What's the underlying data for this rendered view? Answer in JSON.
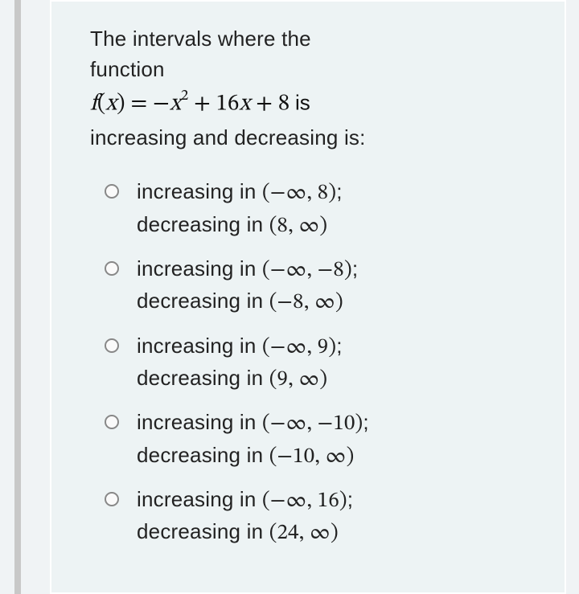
{
  "question": {
    "stem_line1": "The intervals where the",
    "stem_line2": "function",
    "math_prefix": "f",
    "math_open": "(",
    "math_var": "x",
    "math_close": ")",
    "math_eq": " = ",
    "math_expr_neg": "−",
    "math_expr_x": "x",
    "math_expr_sup": "2",
    "math_expr_rest": " + 16",
    "math_expr_x2": "x",
    "math_expr_const": " + 8 ",
    "math_tail": "is",
    "stem_line3": "increasing and decreasing is:"
  },
  "options": [
    {
      "line1_text": "increasing in ",
      "line1_interval": "(−∞, 8)",
      "line1_semi": ";",
      "line2_text": "decreasing in ",
      "line2_interval": "(8, ∞)"
    },
    {
      "line1_text": "increasing in ",
      "line1_interval": "(−∞, −8)",
      "line1_semi": ";",
      "line2_text": "decreasing in ",
      "line2_interval": "(−8, ∞)"
    },
    {
      "line1_text": "increasing in ",
      "line1_interval": "(−∞, 9)",
      "line1_semi": ";",
      "line2_text": "decreasing in ",
      "line2_interval": "(9, ∞)"
    },
    {
      "line1_text": "increasing in ",
      "line1_interval": "(−∞, −10)",
      "line1_semi": ";",
      "line2_text": "decreasing in ",
      "line2_interval": "(−10, ∞)"
    },
    {
      "line1_text": "increasing in ",
      "line1_interval": "(−∞, 16)",
      "line1_semi": ";",
      "line2_text": "decreasing in ",
      "line2_interval": "(24, ∞)"
    }
  ]
}
